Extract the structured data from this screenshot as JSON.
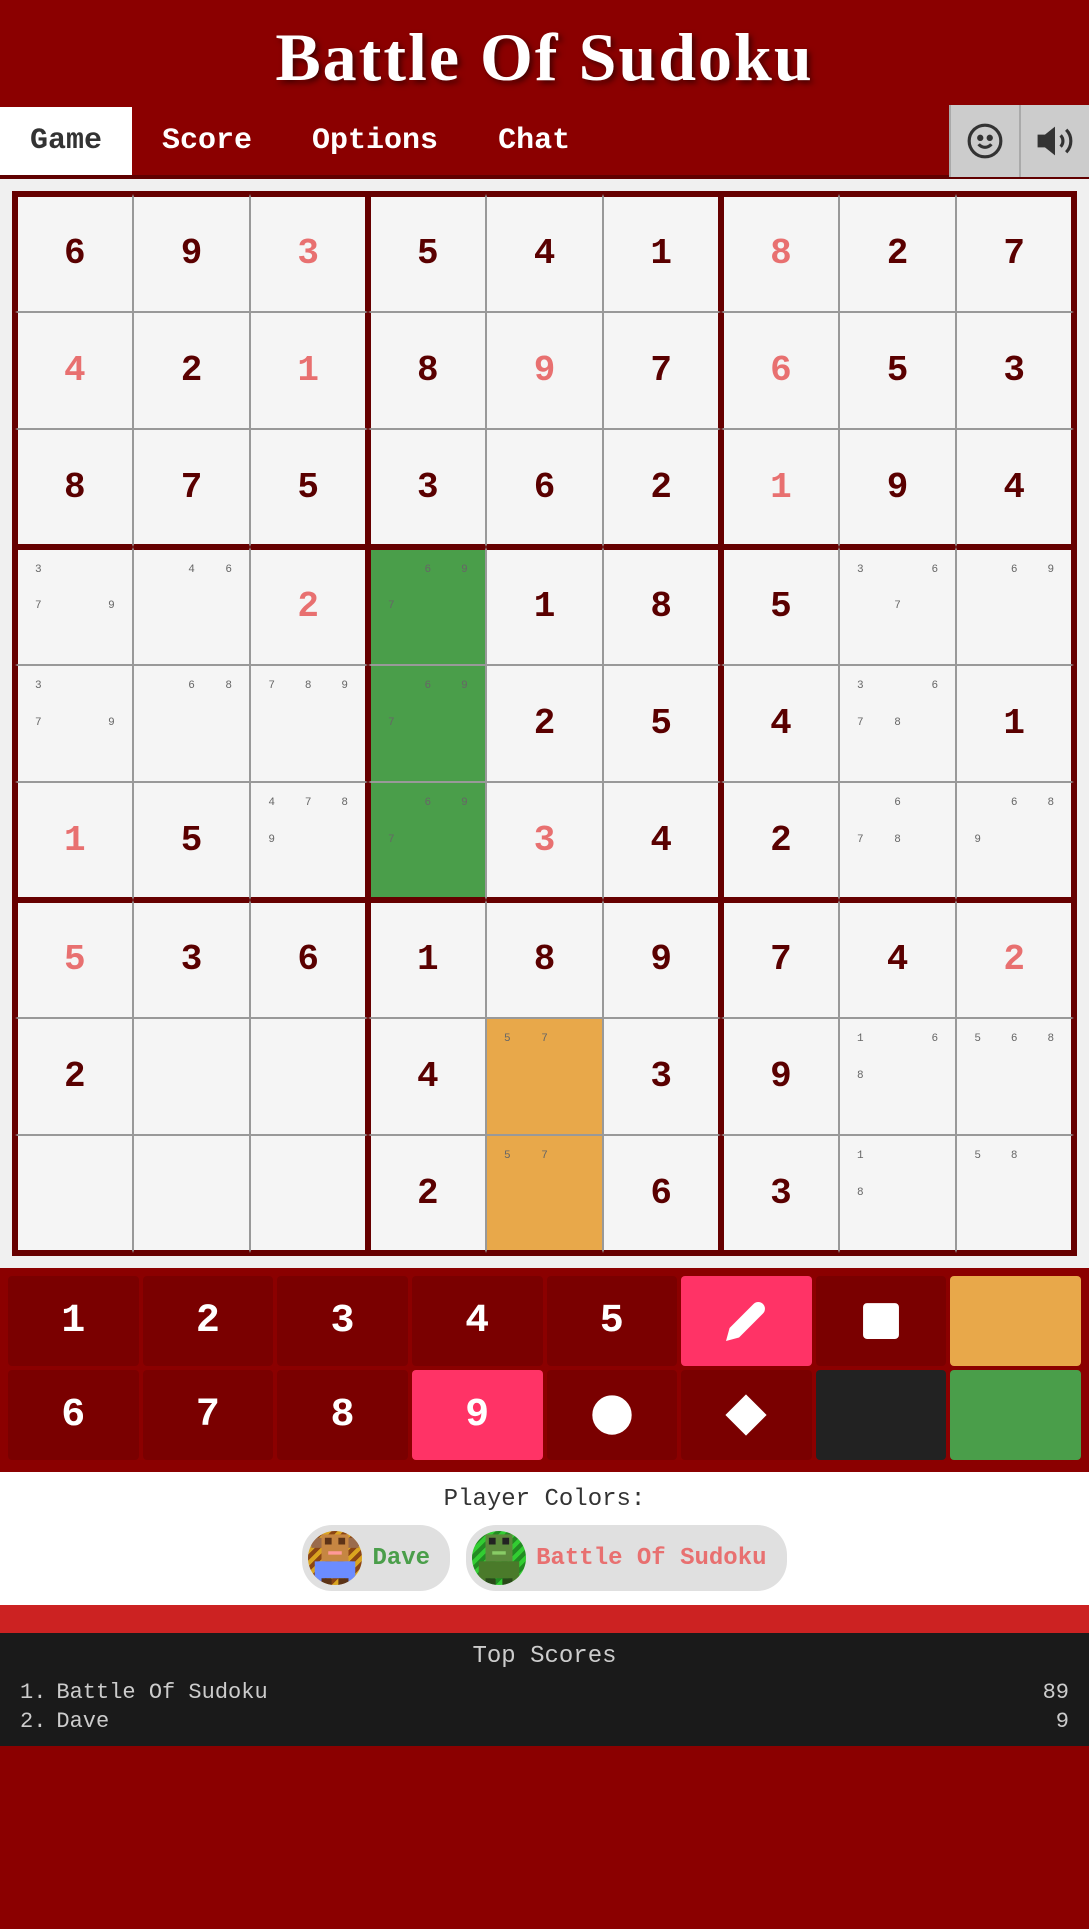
{
  "header": {
    "title": "Battle Of Sudoku"
  },
  "nav": {
    "tabs": [
      "Game",
      "Score",
      "Options",
      "Chat"
    ],
    "active_tab": "Game"
  },
  "grid": {
    "rows": [
      [
        {
          "val": "6",
          "type": "given",
          "notes": null,
          "bg": ""
        },
        {
          "val": "9",
          "type": "given",
          "notes": null,
          "bg": ""
        },
        {
          "val": "3",
          "type": "player",
          "notes": null,
          "bg": ""
        },
        {
          "val": "5",
          "type": "given",
          "notes": null,
          "bg": ""
        },
        {
          "val": "4",
          "type": "given",
          "notes": null,
          "bg": ""
        },
        {
          "val": "1",
          "type": "given",
          "notes": null,
          "bg": ""
        },
        {
          "val": "8",
          "type": "player",
          "notes": null,
          "bg": ""
        },
        {
          "val": "2",
          "type": "given",
          "notes": null,
          "bg": ""
        },
        {
          "val": "7",
          "type": "given",
          "notes": null,
          "bg": ""
        }
      ],
      [
        {
          "val": "4",
          "type": "player",
          "notes": null,
          "bg": ""
        },
        {
          "val": "2",
          "type": "given",
          "notes": null,
          "bg": ""
        },
        {
          "val": "1",
          "type": "player",
          "notes": null,
          "bg": ""
        },
        {
          "val": "8",
          "type": "given",
          "notes": null,
          "bg": ""
        },
        {
          "val": "9",
          "type": "player",
          "notes": null,
          "bg": ""
        },
        {
          "val": "7",
          "type": "given",
          "notes": null,
          "bg": ""
        },
        {
          "val": "6",
          "type": "player",
          "notes": null,
          "bg": ""
        },
        {
          "val": "5",
          "type": "given",
          "notes": null,
          "bg": ""
        },
        {
          "val": "3",
          "type": "given",
          "notes": null,
          "bg": ""
        }
      ],
      [
        {
          "val": "8",
          "type": "given",
          "notes": null,
          "bg": ""
        },
        {
          "val": "7",
          "type": "given",
          "notes": null,
          "bg": ""
        },
        {
          "val": "5",
          "type": "given",
          "notes": null,
          "bg": ""
        },
        {
          "val": "3",
          "type": "given",
          "notes": null,
          "bg": ""
        },
        {
          "val": "6",
          "type": "given",
          "notes": null,
          "bg": ""
        },
        {
          "val": "2",
          "type": "given",
          "notes": null,
          "bg": ""
        },
        {
          "val": "1",
          "type": "player",
          "notes": null,
          "bg": ""
        },
        {
          "val": "9",
          "type": "given",
          "notes": null,
          "bg": ""
        },
        {
          "val": "4",
          "type": "given",
          "notes": null,
          "bg": ""
        }
      ],
      [
        {
          "val": "",
          "type": "given",
          "notes": [
            "3",
            "",
            "",
            "7",
            "",
            "9"
          ],
          "bg": ""
        },
        {
          "val": "",
          "type": "given",
          "notes": [
            "",
            "4",
            "6",
            "",
            "",
            ""
          ],
          "bg": ""
        },
        {
          "val": "2",
          "type": "player",
          "notes": null,
          "bg": ""
        },
        {
          "val": "",
          "type": "given",
          "notes": [
            "",
            "6",
            "9",
            "7",
            "",
            ""
          ],
          "bg": "green"
        },
        {
          "val": "1",
          "type": "given",
          "notes": null,
          "bg": ""
        },
        {
          "val": "8",
          "type": "given",
          "notes": null,
          "bg": ""
        },
        {
          "val": "5",
          "type": "given",
          "notes": null,
          "bg": ""
        },
        {
          "val": "",
          "type": "given",
          "notes": [
            "3",
            "",
            "6",
            "",
            "7",
            ""
          ],
          "bg": ""
        },
        {
          "val": "",
          "type": "given",
          "notes": [
            "",
            "6",
            "9",
            "",
            "",
            ""
          ],
          "bg": ""
        }
      ],
      [
        {
          "val": "",
          "type": "given",
          "notes": [
            "3",
            "",
            "",
            "7",
            "",
            "9"
          ],
          "bg": ""
        },
        {
          "val": "",
          "type": "given",
          "notes": [
            "",
            "6",
            "8",
            "",
            "",
            ""
          ],
          "bg": ""
        },
        {
          "val": "",
          "type": "given",
          "notes": [
            "7",
            "8",
            "9",
            "",
            "",
            ""
          ],
          "bg": ""
        },
        {
          "val": "",
          "type": "given",
          "notes": [
            "",
            "6",
            "9",
            "7",
            "",
            ""
          ],
          "bg": "green"
        },
        {
          "val": "2",
          "type": "given",
          "notes": null,
          "bg": ""
        },
        {
          "val": "5",
          "type": "given",
          "notes": null,
          "bg": ""
        },
        {
          "val": "4",
          "type": "given",
          "notes": null,
          "bg": ""
        },
        {
          "val": "",
          "type": "given",
          "notes": [
            "3",
            "",
            "6",
            "7",
            "8",
            ""
          ],
          "bg": ""
        },
        {
          "val": "1",
          "type": "given",
          "notes": null,
          "bg": ""
        }
      ],
      [
        {
          "val": "1",
          "type": "player",
          "notes": null,
          "bg": ""
        },
        {
          "val": "5",
          "type": "given",
          "notes": null,
          "bg": ""
        },
        {
          "val": "",
          "type": "given",
          "notes": [
            "4",
            "7",
            "8",
            "9",
            "",
            ""
          ],
          "bg": ""
        },
        {
          "val": "",
          "type": "given",
          "notes": [
            "",
            "6",
            "9",
            "7",
            "",
            ""
          ],
          "bg": "green"
        },
        {
          "val": "3",
          "type": "player",
          "notes": null,
          "bg": ""
        },
        {
          "val": "4",
          "type": "given",
          "notes": null,
          "bg": ""
        },
        {
          "val": "2",
          "type": "given",
          "notes": null,
          "bg": ""
        },
        {
          "val": "",
          "type": "given",
          "notes": [
            "",
            "6",
            "",
            "7",
            "8",
            ""
          ],
          "bg": ""
        },
        {
          "val": "",
          "type": "given",
          "notes": [
            "",
            "6",
            "8",
            "9",
            "",
            ""
          ],
          "bg": ""
        }
      ],
      [
        {
          "val": "5",
          "type": "player",
          "notes": null,
          "bg": ""
        },
        {
          "val": "3",
          "type": "given",
          "notes": null,
          "bg": ""
        },
        {
          "val": "6",
          "type": "given",
          "notes": null,
          "bg": ""
        },
        {
          "val": "1",
          "type": "given",
          "notes": null,
          "bg": ""
        },
        {
          "val": "8",
          "type": "given",
          "notes": null,
          "bg": ""
        },
        {
          "val": "9",
          "type": "given",
          "notes": null,
          "bg": ""
        },
        {
          "val": "7",
          "type": "given",
          "notes": null,
          "bg": ""
        },
        {
          "val": "4",
          "type": "given",
          "notes": null,
          "bg": ""
        },
        {
          "val": "2",
          "type": "player",
          "notes": null,
          "bg": ""
        }
      ],
      [
        {
          "val": "2",
          "type": "given",
          "notes": null,
          "bg": ""
        },
        {
          "val": "",
          "type": "given",
          "notes": null,
          "bg": ""
        },
        {
          "val": "",
          "type": "given",
          "notes": null,
          "bg": ""
        },
        {
          "val": "4",
          "type": "given",
          "notes": null,
          "bg": ""
        },
        {
          "val": "",
          "type": "given",
          "notes": [
            "5",
            "7",
            "",
            "",
            "",
            ""
          ],
          "bg": "orange"
        },
        {
          "val": "3",
          "type": "given",
          "notes": null,
          "bg": ""
        },
        {
          "val": "9",
          "type": "given",
          "notes": null,
          "bg": ""
        },
        {
          "val": "",
          "type": "given",
          "notes": [
            "1",
            "",
            "6",
            "8",
            "",
            ""
          ],
          "bg": ""
        },
        {
          "val": "",
          "type": "given",
          "notes": [
            "5",
            "6",
            "8",
            "",
            "",
            ""
          ],
          "bg": ""
        }
      ],
      [
        {
          "val": "",
          "type": "given",
          "notes": null,
          "bg": ""
        },
        {
          "val": "",
          "type": "given",
          "notes": null,
          "bg": ""
        },
        {
          "val": "",
          "type": "given",
          "notes": null,
          "bg": ""
        },
        {
          "val": "2",
          "type": "given",
          "notes": null,
          "bg": ""
        },
        {
          "val": "",
          "type": "given",
          "notes": [
            "5",
            "7",
            "",
            "",
            "",
            ""
          ],
          "bg": "orange"
        },
        {
          "val": "6",
          "type": "given",
          "notes": null,
          "bg": ""
        },
        {
          "val": "3",
          "type": "given",
          "notes": null,
          "bg": ""
        },
        {
          "val": "",
          "type": "given",
          "notes": [
            "1",
            "",
            "",
            "8",
            "",
            ""
          ],
          "bg": ""
        },
        {
          "val": "",
          "type": "given",
          "notes": [
            "5",
            "8",
            "",
            "",
            "",
            ""
          ],
          "bg": ""
        }
      ]
    ]
  },
  "numpad": {
    "row1": [
      "1",
      "2",
      "3",
      "4",
      "5",
      "pencil",
      "square",
      "orange"
    ],
    "row2": [
      "6",
      "7",
      "8",
      "9",
      "no",
      "diamond",
      "black",
      "green"
    ],
    "active_num": "9",
    "active_tool": "pencil"
  },
  "player_colors": {
    "label": "Player Colors:",
    "players": [
      {
        "name": "Dave",
        "color": "green"
      },
      {
        "name": "Battle Of Sudoku",
        "color": "red"
      }
    ]
  },
  "top_scores": {
    "title": "Top Scores",
    "entries": [
      {
        "rank": "1.",
        "name": "Battle Of Sudoku",
        "score": "89"
      },
      {
        "rank": "2.",
        "name": "Dave",
        "score": "9"
      }
    ]
  }
}
